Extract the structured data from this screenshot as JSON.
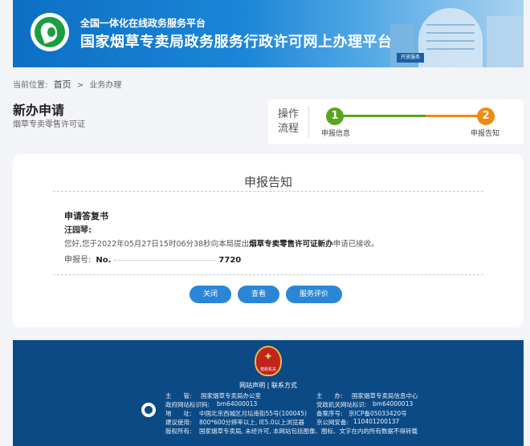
{
  "header": {
    "subtitle": "全国一体化在线政务服务平台",
    "title": "国家烟草专卖局政务服务行政许可网上办理平台",
    "badge": "开放服务"
  },
  "breadcrumb": {
    "prefix": "当前位置:",
    "home": "首页",
    "sep": ">",
    "current": "业务办理"
  },
  "page": {
    "title": "新办申请",
    "subtitle": "烟草专卖零售许可证"
  },
  "flow": {
    "label": "操作流程",
    "steps": [
      {
        "num": "1",
        "label": "申报信息"
      },
      {
        "num": "2",
        "label": "申报告知"
      }
    ]
  },
  "notice": {
    "title": "申报告知",
    "letter_title": "申请答复书",
    "addressee": "汪园琴:",
    "message_before": "您好,您于2022年05月27日15时06分38秒向本局提出",
    "message_bold": "烟草专卖零售许可证新办",
    "message_after": "申请已接收。",
    "number_label": "申报号:",
    "number_prefix": "No.",
    "number_tail": "7720"
  },
  "buttons": {
    "close": "关闭",
    "view": "查看",
    "evaluate": "服务评价"
  },
  "footer": {
    "emblem_text": "党政机关",
    "links": "网站声明 | 联系方式",
    "rows": [
      [
        "主　　管:",
        "国家烟草专卖局办公室",
        "主　　办:",
        "国家烟草专卖局信息中心"
      ],
      [
        "政府网站标识码:",
        "bm64000013",
        "党政机关网站标识:",
        "bm64000013"
      ],
      [
        "地　　址:",
        "中国北京西城区月坛南街55号(100045)",
        "备案序号:",
        "京ICP备05033420号"
      ],
      [
        "建议使用:",
        "800*600分辨率以上, IE5.0以上浏览器",
        "京公网安备:",
        "110401200137"
      ],
      [
        "版权所有:",
        "国家烟草专卖局, 未经许可, 本网站包括图像、图标、文字在内的所有数据不得转载",
        "",
        ""
      ]
    ]
  }
}
